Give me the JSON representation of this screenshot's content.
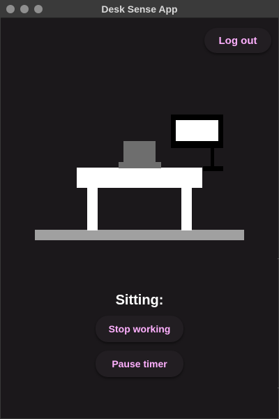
{
  "window": {
    "title": "Desk Sense App"
  },
  "header": {
    "logout_label": "Log out"
  },
  "status": {
    "label": "Sitting:"
  },
  "actions": {
    "stop_label": "Stop working",
    "pause_label": "Pause timer"
  },
  "colors": {
    "background": "#1b181b",
    "accent_text": "#ffb0ff",
    "desk": "#ffffff",
    "floor": "#a0a0a0",
    "laptop": "#6e6e6e"
  }
}
